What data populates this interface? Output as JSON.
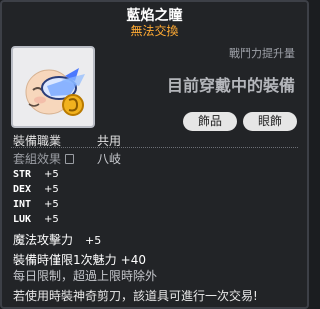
{
  "item": {
    "name": "藍焰之瞳",
    "trade_status": "無法交換",
    "icon": "blue-flame-eye-accessory-icon"
  },
  "compare": {
    "label": "戰鬥力提升量",
    "equipped_text": "目前穿戴中的裝備"
  },
  "tags": [
    "飾品",
    "眼飾"
  ],
  "job": {
    "label": "裝備職業",
    "value": "共用"
  },
  "set_effect": {
    "label": "套組效果",
    "value": "八岐"
  },
  "stats": [
    {
      "name": "STR",
      "value": "+5"
    },
    {
      "name": "DEX",
      "value": "+5"
    },
    {
      "name": "INT",
      "value": "+5"
    },
    {
      "name": "LUK",
      "value": "+5"
    }
  ],
  "magic_attack": {
    "label": "魔法攻擊力",
    "value": "+5"
  },
  "equip_limit": {
    "label": "裝備時僅限1次魅力",
    "value": "+40"
  },
  "daily_limit": "每日限制，超過上限時除外",
  "scissors_note": "若使用時裝神奇剪刀，該道具可進行一次交易!",
  "colors": {
    "title": "#ffffff",
    "untradeable": "#ffaa33",
    "background": "#222428"
  }
}
